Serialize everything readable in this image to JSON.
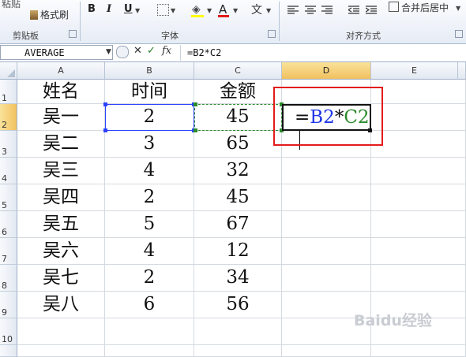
{
  "ribbon": {
    "paste_label": "粘贴",
    "format_painter_label": "格式刷",
    "clipboard_group": "剪贴板",
    "font_group": "字体",
    "alignment_group": "对齐方式",
    "bold": "B",
    "italic": "I",
    "underline": "U",
    "font_color_glyph": "A",
    "phonetic_glyph": "文",
    "merge_center_label": "合并后居中"
  },
  "formula_bar": {
    "name_box": "AVERAGE",
    "cancel_glyph": "✕",
    "enter_glyph": "✓",
    "fx_glyph": "fx",
    "formula": "=B2*C2"
  },
  "columns": [
    "A",
    "B",
    "C",
    "D",
    "E"
  ],
  "rows": [
    "1",
    "2",
    "3",
    "4",
    "5",
    "6",
    "7",
    "8",
    "9",
    "10"
  ],
  "table": {
    "headers": [
      "姓名",
      "时间",
      "金额"
    ],
    "records": [
      [
        "吴一",
        "2",
        "45"
      ],
      [
        "吴二",
        "3",
        "65"
      ],
      [
        "吴三",
        "4",
        "32"
      ],
      [
        "吴四",
        "2",
        "45"
      ],
      [
        "吴五",
        "5",
        "67"
      ],
      [
        "吴六",
        "4",
        "12"
      ],
      [
        "吴七",
        "2",
        "34"
      ],
      [
        "吴八",
        "6",
        "56"
      ]
    ]
  },
  "editing_cell": {
    "eq": "=",
    "ref1": "B2",
    "op": "*",
    "ref2": "C2"
  },
  "watermark": "Baidu经验",
  "colors": {
    "ref_b": "#1f36e6",
    "ref_c": "#2a8a2a",
    "highlight": "#e31b1b",
    "selected_header": "#f1c15f"
  }
}
